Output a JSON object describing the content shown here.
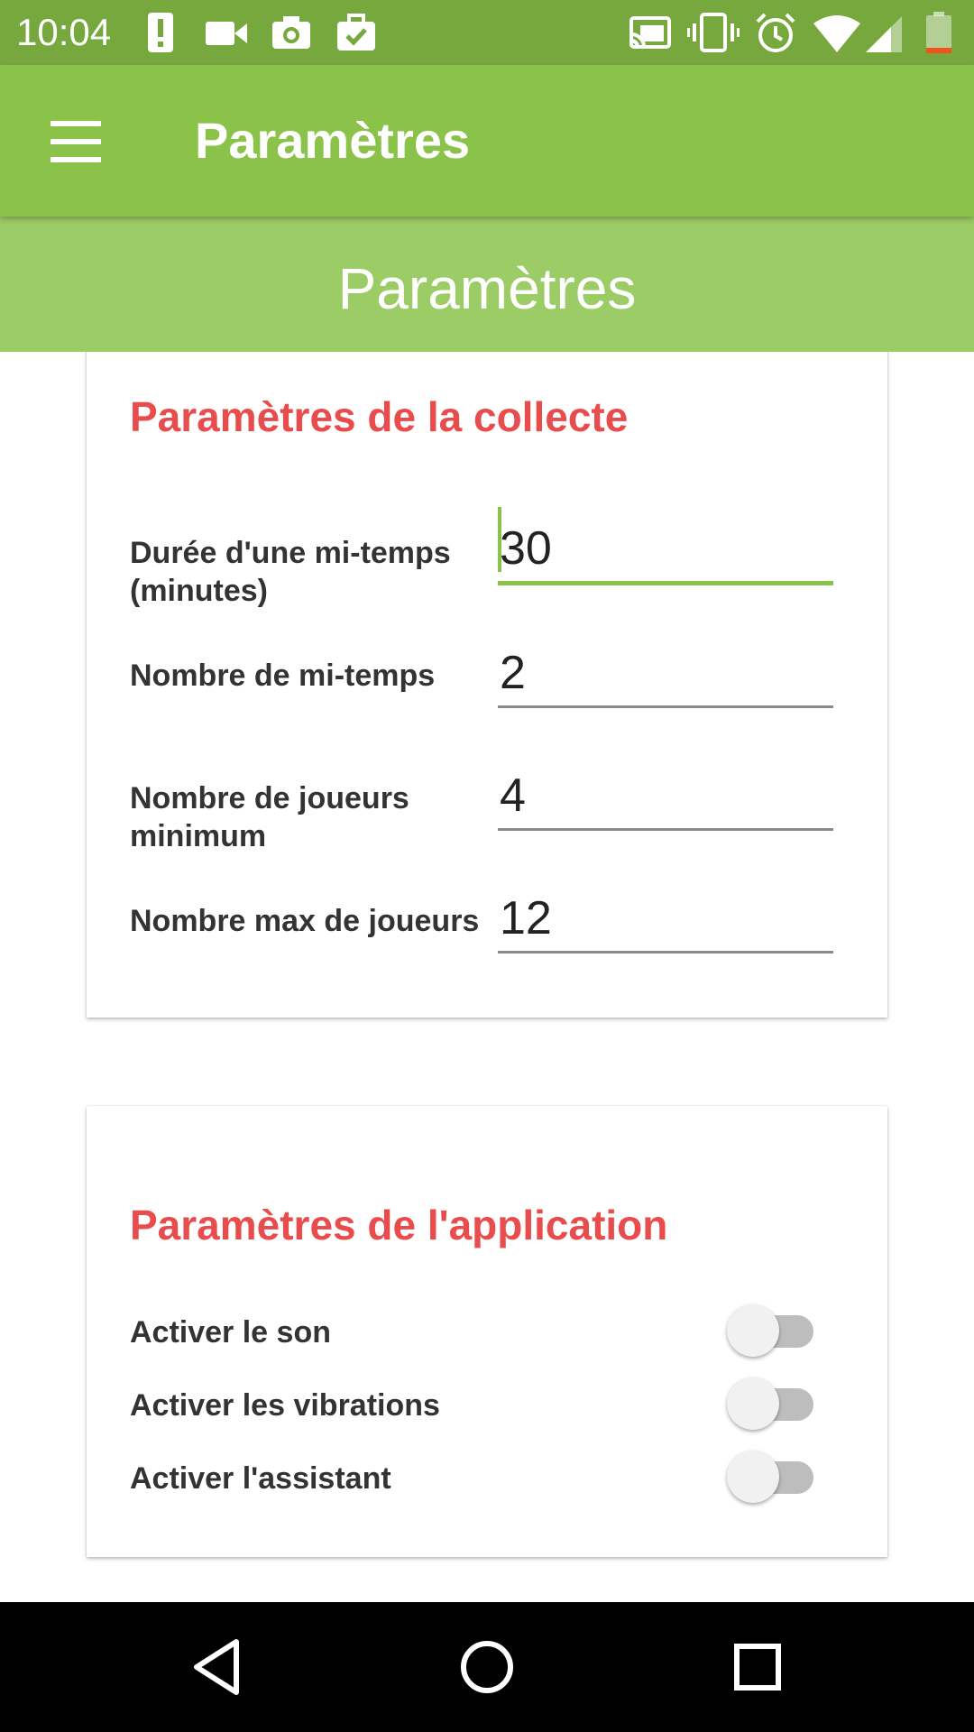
{
  "status_bar": {
    "time": "10:04",
    "icons_left": [
      "alert-icon",
      "video-icon",
      "camera-icon",
      "briefcase-check-icon"
    ],
    "icons_right": [
      "cast-icon",
      "vibrate-icon",
      "alarm-icon",
      "wifi-icon",
      "signal-icon",
      "battery-icon"
    ]
  },
  "app_bar": {
    "menu_icon": "hamburger-menu-icon",
    "title": "Paramètres"
  },
  "sub_header": {
    "title": "Paramètres"
  },
  "collect_card": {
    "title": "Paramètres de la collecte",
    "fields": [
      {
        "label": "Durée d'une mi-temps (minutes)",
        "value": "30",
        "focused": true
      },
      {
        "label": "Nombre de mi-temps",
        "value": "2"
      },
      {
        "label": "Nombre de joueurs minimum",
        "value": "4"
      },
      {
        "label": "Nombre max de joueurs",
        "value": "12"
      }
    ]
  },
  "app_card": {
    "title": "Paramètres de l'application",
    "toggles": [
      {
        "label": "Activer le son",
        "on": false
      },
      {
        "label": "Activer les vibrations",
        "on": false
      },
      {
        "label": "Activer l'assistant",
        "on": false
      }
    ]
  },
  "nav_bar": {
    "buttons": [
      "back-icon",
      "home-icon",
      "recents-icon"
    ]
  },
  "colors": {
    "status_bar": "#76a83e",
    "app_bar": "#8bc34a",
    "sub_header": "#9ccc65",
    "card_title": "#e84c4c",
    "accent": "#8bc34a"
  }
}
